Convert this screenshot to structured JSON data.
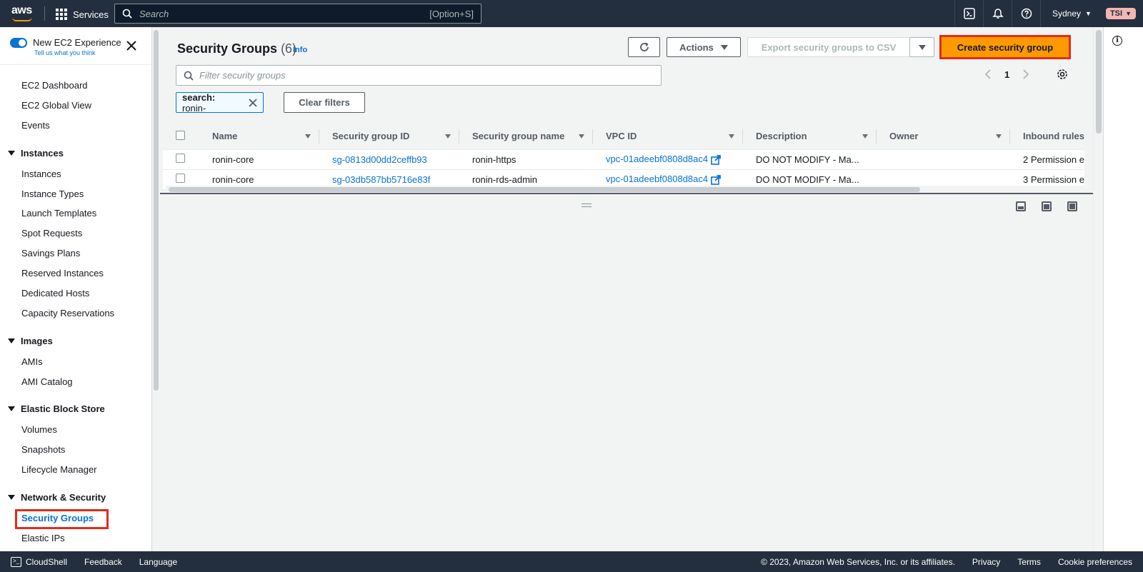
{
  "topnav": {
    "logo_text": "aws",
    "services_label": "Services",
    "search_placeholder": "Search",
    "search_shortcut": "[Option+S]",
    "region": "Sydney",
    "account": "TSI"
  },
  "sidebar": {
    "toggle_label": "New EC2 Experience",
    "toggle_sublabel": "Tell us what you think",
    "top_links": [
      "EC2 Dashboard",
      "EC2 Global View",
      "Events"
    ],
    "sections": [
      {
        "title": "Instances",
        "items": [
          "Instances",
          "Instance Types",
          "Launch Templates",
          "Spot Requests",
          "Savings Plans",
          "Reserved Instances",
          "Dedicated Hosts",
          "Capacity Reservations"
        ]
      },
      {
        "title": "Images",
        "items": [
          "AMIs",
          "AMI Catalog"
        ]
      },
      {
        "title": "Elastic Block Store",
        "items": [
          "Volumes",
          "Snapshots",
          "Lifecycle Manager"
        ]
      },
      {
        "title": "Network & Security",
        "items": [
          "Security Groups",
          "Elastic IPs"
        ]
      }
    ]
  },
  "main": {
    "title": "Security Groups",
    "count": "(6)",
    "info": "Info",
    "actions_label": "Actions",
    "export_label": "Export security groups to CSV",
    "create_label": "Create security group",
    "filter_placeholder": "Filter security groups",
    "page_number": "1",
    "chip_key": "search:",
    "chip_value": "ronin-",
    "clear_filters": "Clear filters",
    "columns": [
      "Name",
      "Security group ID",
      "Security group name",
      "VPC ID",
      "Description",
      "Owner",
      "Inbound rules"
    ],
    "rows": [
      {
        "name": "ronin-core",
        "sg_id": "sg-0813d00dd2ceffb93",
        "sg_name": "ronin-https",
        "vpc_id": "vpc-01adeebf0808d8ac4",
        "description": "DO NOT MODIFY - Ma...",
        "owner": "",
        "inbound": "2 Permission e"
      },
      {
        "name": "ronin-core",
        "sg_id": "sg-03db587bb5716e83f",
        "sg_name": "ronin-rds-admin",
        "vpc_id": "vpc-01adeebf0808d8ac4",
        "description": "DO NOT MODIFY - Ma...",
        "owner": "",
        "inbound": "3 Permission e"
      }
    ]
  },
  "footer": {
    "cloudshell": "CloudShell",
    "feedback": "Feedback",
    "language": "Language",
    "copyright": "© 2023, Amazon Web Services, Inc. or its affiliates.",
    "privacy": "Privacy",
    "terms": "Terms",
    "cookie": "Cookie preferences"
  },
  "colors": {
    "nav_bg": "#232f3e",
    "link": "#0972d3",
    "primary_button": "#ff9900",
    "highlight_box": "#e02d1b"
  }
}
